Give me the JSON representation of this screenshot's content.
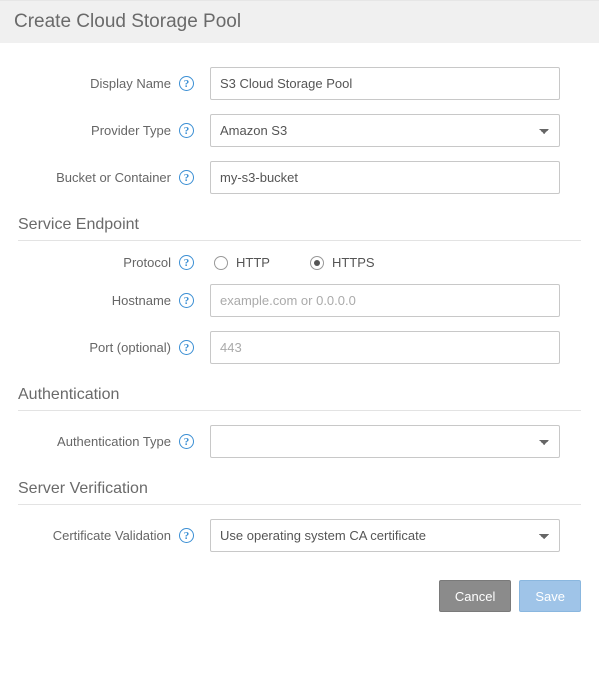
{
  "header": {
    "title": "Create Cloud Storage Pool"
  },
  "fields": {
    "display_name": {
      "label": "Display Name",
      "value": "S3 Cloud Storage Pool"
    },
    "provider_type": {
      "label": "Provider Type",
      "value": "Amazon S3"
    },
    "bucket": {
      "label": "Bucket or Container",
      "value": "my-s3-bucket"
    }
  },
  "sections": {
    "endpoint": {
      "title": "Service Endpoint",
      "protocol": {
        "label": "Protocol",
        "http_label": "HTTP",
        "https_label": "HTTPS",
        "selected": "https"
      },
      "hostname": {
        "label": "Hostname",
        "placeholder": "example.com or 0.0.0.0",
        "value": ""
      },
      "port": {
        "label": "Port (optional)",
        "placeholder": "443",
        "value": ""
      }
    },
    "auth": {
      "title": "Authentication",
      "auth_type": {
        "label": "Authentication Type",
        "value": ""
      }
    },
    "verify": {
      "title": "Server Verification",
      "cert": {
        "label": "Certificate Validation",
        "value": "Use operating system CA certificate"
      }
    }
  },
  "footer": {
    "cancel": "Cancel",
    "save": "Save"
  },
  "icons": {
    "help": "?"
  }
}
